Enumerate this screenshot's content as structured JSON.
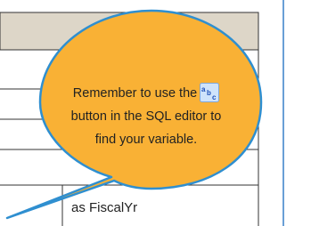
{
  "callout": {
    "line1_prefix": "Remember to use the",
    "line2": "button in the SQL editor to",
    "line3": "find your variable.",
    "icon": "abc-variable-icon",
    "fill_color": "#f9b135",
    "border_color": "#2f8fd0"
  },
  "table": {
    "visible_cell": "as FiscalYr",
    "header_band_color": "#ddd6c8"
  }
}
